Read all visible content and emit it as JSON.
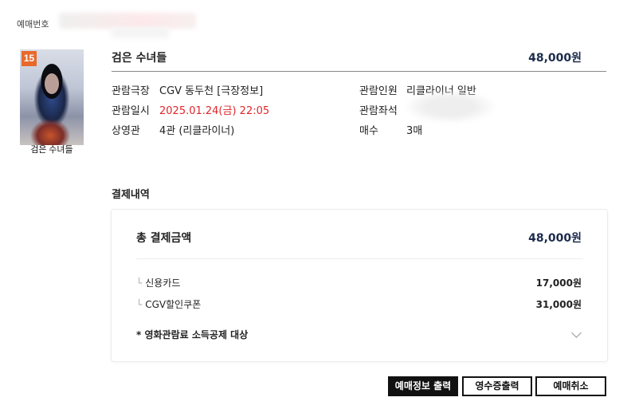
{
  "reservation": {
    "label": "예매번호"
  },
  "poster": {
    "rating": "15",
    "caption": "검은 수녀들"
  },
  "movie": {
    "title": "검은 수녀들",
    "total_price": "48,000원"
  },
  "details": {
    "theater_label": "관람극장",
    "theater_value": "CGV 동두천 [극장정보]",
    "datetime_label": "관람일시",
    "datetime_value": "2025.01.24(금) 22:05",
    "screen_label": "상영관",
    "screen_value": "4관 (리클라이너)",
    "audience_label": "관람인원",
    "audience_value": "리클라이너 일반",
    "seat_label": "관람좌석",
    "count_label": "매수",
    "count_value": "3매"
  },
  "payment": {
    "section_title": "결제내역",
    "total_label": "총 결제금액",
    "total_value": "48,000원",
    "items": [
      {
        "label": "신용카드",
        "amount": "17,000원"
      },
      {
        "label": "CGV할인쿠폰",
        "amount": "31,000원"
      }
    ],
    "tax_deduction": "* 영화관람료 소득공제 대상"
  },
  "buttons": {
    "print_ticket": "예매정보 출력",
    "receipt": "영수증출력",
    "cancel": "예매취소"
  },
  "colors": {
    "accent_navy": "#1c2b4d",
    "datetime_red": "#e0262b",
    "button_dark": "#111111"
  },
  "icons": {
    "branch": "branch-corner-icon",
    "expand": "chevron-down-icon"
  }
}
